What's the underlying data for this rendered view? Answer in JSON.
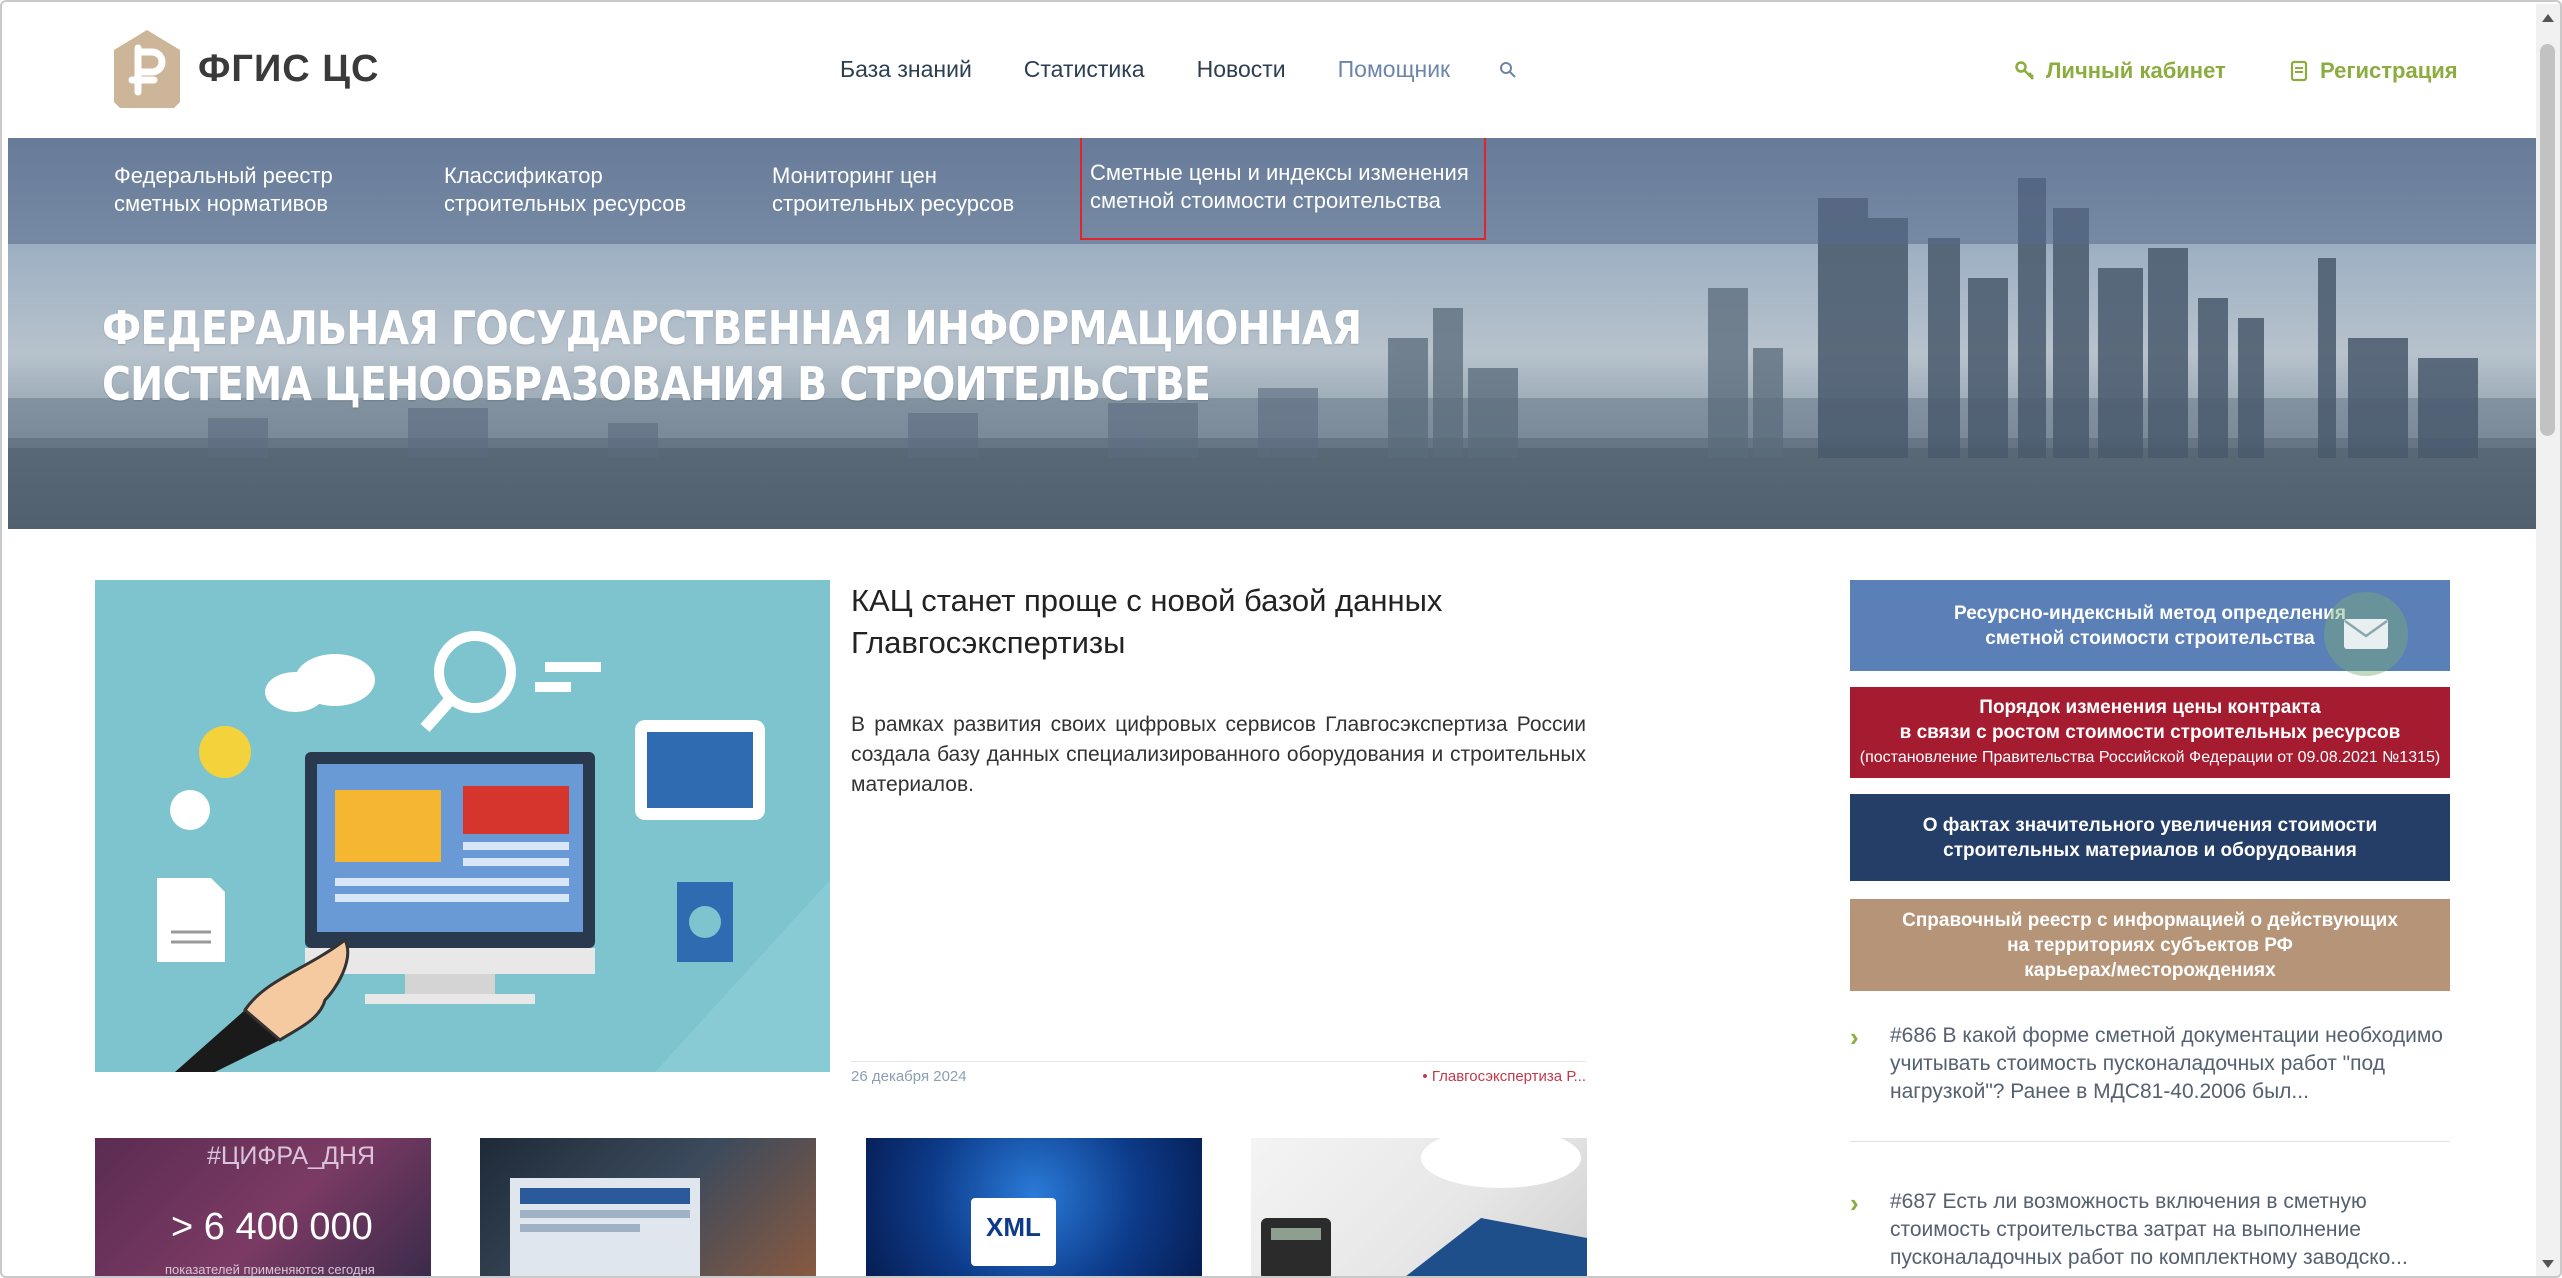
{
  "header": {
    "logo_text": "ФГИС ЦС",
    "nav": [
      {
        "label": "База знаний"
      },
      {
        "label": "Статистика"
      },
      {
        "label": "Новости"
      },
      {
        "label": "Помощник"
      }
    ],
    "cabinet_label": "Личный кабинет",
    "register_label": "Регистрация",
    "accent_color": "#8cac3f"
  },
  "hero": {
    "menu": [
      {
        "line1": "Федеральный реестр",
        "line2": "сметных нормативов"
      },
      {
        "line1": "Классификатор",
        "line2": "строительных ресурсов"
      },
      {
        "line1": "Мониторинг цен",
        "line2": "строительных ресурсов"
      },
      {
        "line1": "Сметные цены и индексы изменения",
        "line2": "сметной стоимости строительства"
      }
    ],
    "title_line1": "ФЕДЕРАЛЬНАЯ ГОСУДАРСТВЕННАЯ ИНФОРМАЦИОННАЯ",
    "title_line2": "СИСТЕМА ЦЕНООБРАЗОВАНИЯ В СТРОИТЕЛЬСТВЕ"
  },
  "news": {
    "title": "КАЦ станет проще с новой базой данных Главгосэкспертизы",
    "text": "В рамках развития своих цифровых сервисов Главгосэкспертиза России создала базу данных специализированного оборудования и строительных материалов.",
    "date": "26 декабря 2024",
    "source": "• Главгосэкспертиза Р..."
  },
  "thumbs": {
    "t1_tag": "#ЦИФРА_ДНЯ",
    "t1_number": "> 6 400 000",
    "t1_sub": "показателей применяются сегодня",
    "t3_label": "XML"
  },
  "sidebar": {
    "banners": [
      {
        "line1": "Ресурсно-индексный метод определения",
        "line2": "сметной стоимости строительства",
        "color": "#5b80b8"
      },
      {
        "line1": "Порядок изменения цены контракта",
        "line2": "в связи с ростом стоимости строительных ресурсов",
        "line3": "(постановление Правительства Российской Федерации от 09.08.2021 №1315)",
        "color": "#a51c30"
      },
      {
        "line1": "О фактах значительного увеличения стоимости",
        "line2": "строительных материалов и оборудования",
        "color": "#253e68"
      },
      {
        "line1": "Справочный реестр с информацией о действующих",
        "line2": "на территориях субъектов РФ",
        "line3": "карьерах/месторождениях",
        "color": "#b59478"
      }
    ],
    "qa": [
      {
        "text": "#686 В какой форме сметной документации необходимо учитывать стоимость пусконаладочных работ \"под нагрузкой\"? Ранее в МДС81-40.2006 был..."
      },
      {
        "text": "#687 Есть ли возможность включения в сметную стоимость строительства затрат на выполнение пусконаладочных работ по комплектному заводско..."
      }
    ]
  }
}
